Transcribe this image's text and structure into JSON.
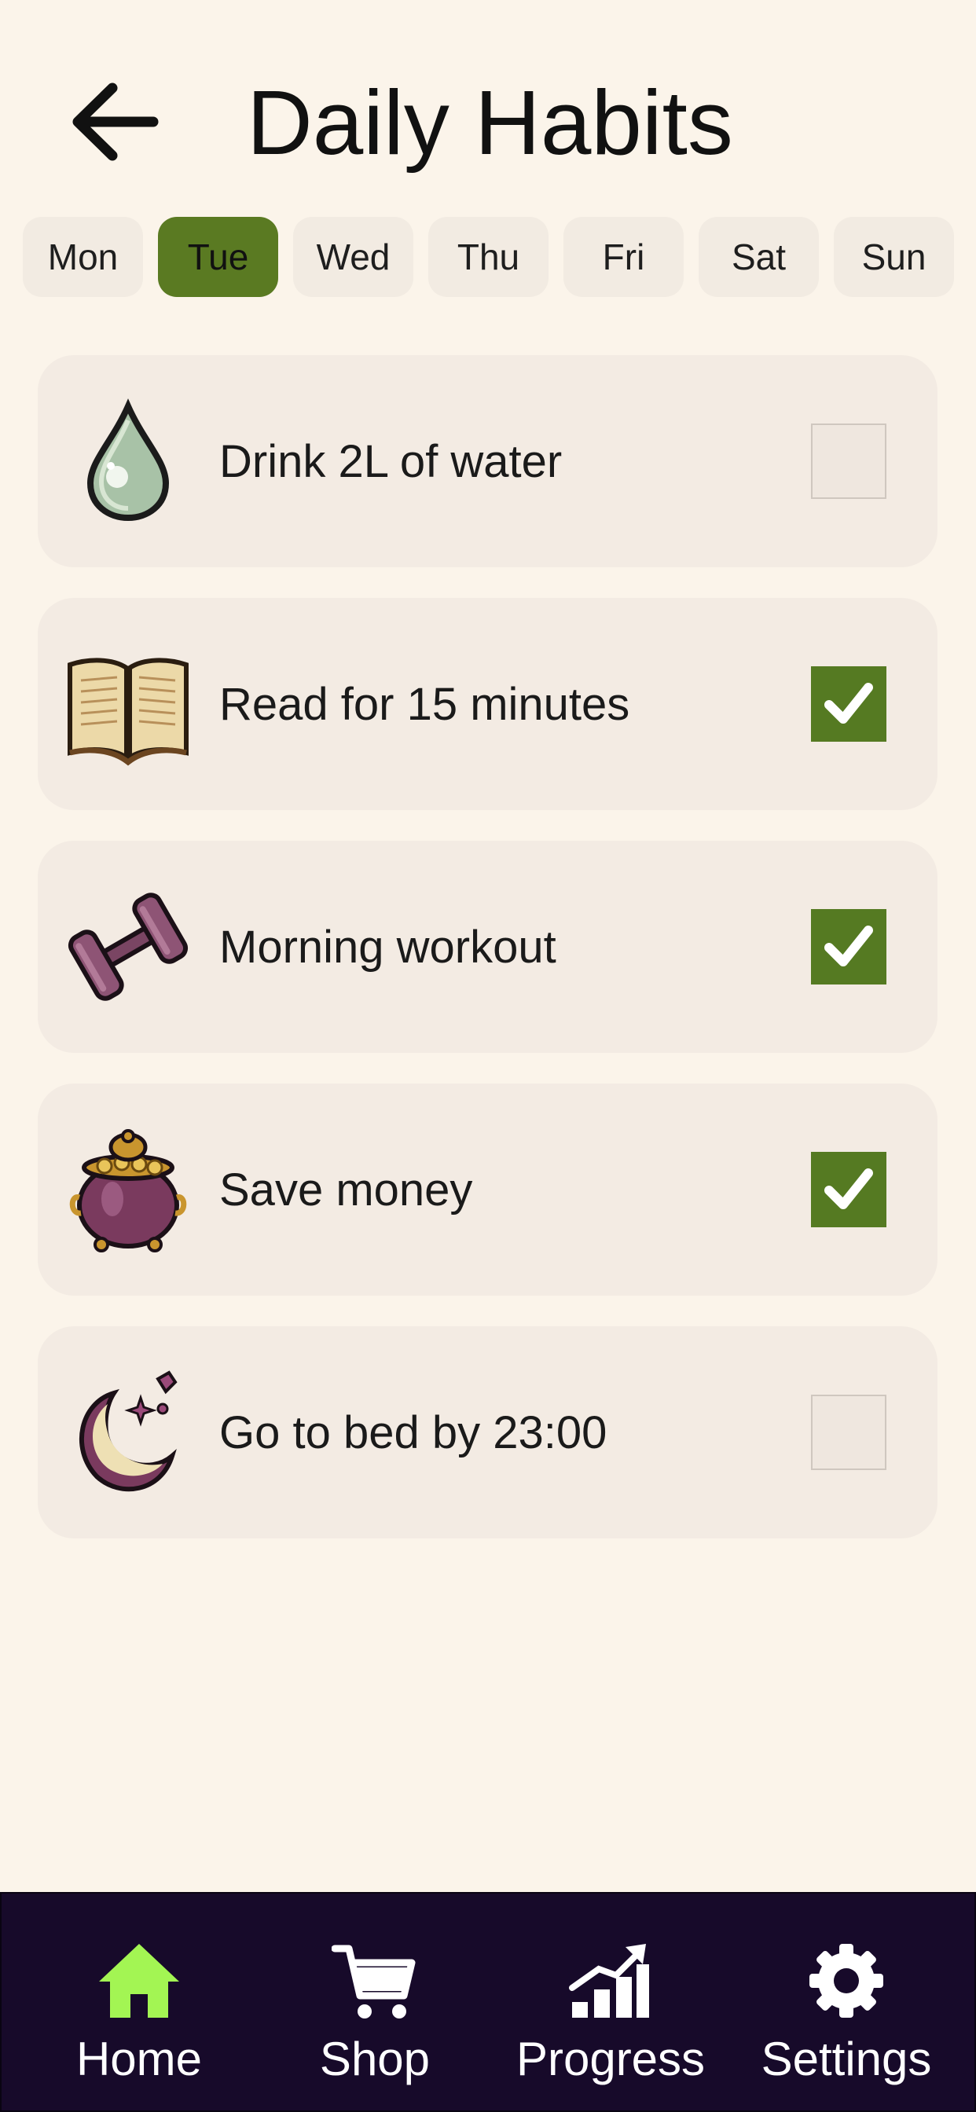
{
  "header": {
    "title": "Daily Habits"
  },
  "days": [
    {
      "label": "Mon",
      "active": false
    },
    {
      "label": "Tue",
      "active": true
    },
    {
      "label": "Wed",
      "active": false
    },
    {
      "label": "Thu",
      "active": false
    },
    {
      "label": "Fri",
      "active": false
    },
    {
      "label": "Sat",
      "active": false
    },
    {
      "label": "Sun",
      "active": false
    }
  ],
  "habits": [
    {
      "label": "Drink 2L of water",
      "icon": "water-drop-icon",
      "checked": false
    },
    {
      "label": "Read for 15 minutes",
      "icon": "open-book-icon",
      "checked": true
    },
    {
      "label": "Morning workout",
      "icon": "dumbbell-icon",
      "checked": true
    },
    {
      "label": "Save money",
      "icon": "money-pot-icon",
      "checked": true
    },
    {
      "label": "Go to bed by 23:00",
      "icon": "moon-icon",
      "checked": false
    }
  ],
  "nav": [
    {
      "label": "Home",
      "icon": "home-icon",
      "active": true
    },
    {
      "label": "Shop",
      "icon": "cart-icon",
      "active": false
    },
    {
      "label": "Progress",
      "icon": "chart-up-icon",
      "active": false
    },
    {
      "label": "Settings",
      "icon": "gear-icon",
      "active": false
    }
  ],
  "colors": {
    "background": "#fbf4ea",
    "accent_green": "#5a7a22",
    "home_icon": "#a3f553",
    "nav_bg": "#170a2a",
    "card_bg": "#f3ebe3"
  }
}
